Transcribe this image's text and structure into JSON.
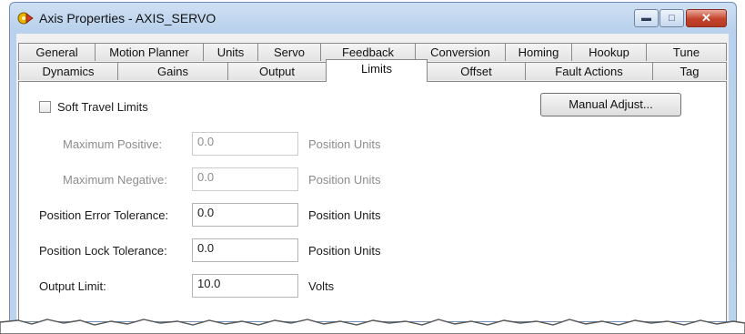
{
  "window": {
    "title": "Axis Properties - AXIS_SERVO",
    "controls": {
      "minimize": "▬",
      "maximize": "□",
      "close": "✕"
    }
  },
  "tabs": {
    "row1": [
      "General",
      "Motion Planner",
      "Units",
      "Servo",
      "Feedback",
      "Conversion",
      "Homing",
      "Hookup",
      "Tune"
    ],
    "row2": [
      "Dynamics",
      "Gains",
      "Output",
      "Limits",
      "Offset",
      "Fault Actions",
      "Tag"
    ],
    "active": "Limits"
  },
  "limits": {
    "soft_travel": {
      "label": "Soft Travel Limits",
      "checked": false
    },
    "manual_adjust": "Manual Adjust...",
    "fields": [
      {
        "label": "Maximum Positive:",
        "value": "0.0",
        "units": "Position Units",
        "enabled": false
      },
      {
        "label": "Maximum Negative:",
        "value": "0.0",
        "units": "Position Units",
        "enabled": false
      },
      {
        "label": "Position Error Tolerance:",
        "value": "0.0",
        "units": "Position Units",
        "enabled": true
      },
      {
        "label": "Position Lock Tolerance:",
        "value": "0.0",
        "units": "Position Units",
        "enabled": true
      },
      {
        "label": "Output Limit:",
        "value": "10.0",
        "units": "Volts",
        "enabled": true
      }
    ]
  },
  "colors": {
    "titlebar": "#b9d1ec",
    "close_button": "#c4412a",
    "dialog_face": "#f0f0f0",
    "disabled_text": "#8c8c8c"
  }
}
